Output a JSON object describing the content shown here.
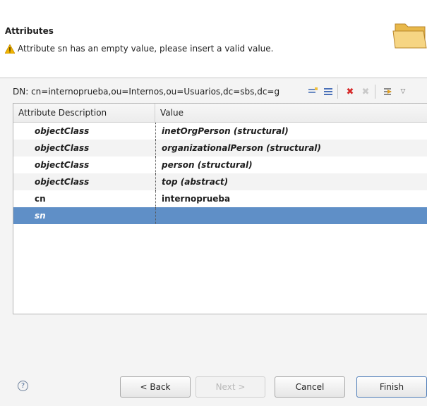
{
  "header": {
    "title": "Attributes",
    "message": "Attribute sn has an empty value, please insert a valid value."
  },
  "dn_bar": {
    "text": "DN: cn=internoprueba,ou=Internos,ou=Usuarios,dc=sbs,dc=g"
  },
  "table": {
    "columns": [
      "Attribute Description",
      "Value"
    ],
    "rows": [
      {
        "attr": "objectClass",
        "value": "inetOrgPerson (structural)"
      },
      {
        "attr": "objectClass",
        "value": "organizationalPerson (structural)"
      },
      {
        "attr": "objectClass",
        "value": "person (structural)"
      },
      {
        "attr": "objectClass",
        "value": "top (abstract)"
      },
      {
        "attr": "cn",
        "value": "internoprueba"
      },
      {
        "attr": "sn",
        "value": ""
      }
    ]
  },
  "buttons": {
    "back": "< Back",
    "next": "Next >",
    "cancel": "Cancel",
    "finish": "Finish"
  },
  "colors": {
    "selection": "#5f8fc7",
    "warning": "#f0b400",
    "delete": "#d62828"
  }
}
